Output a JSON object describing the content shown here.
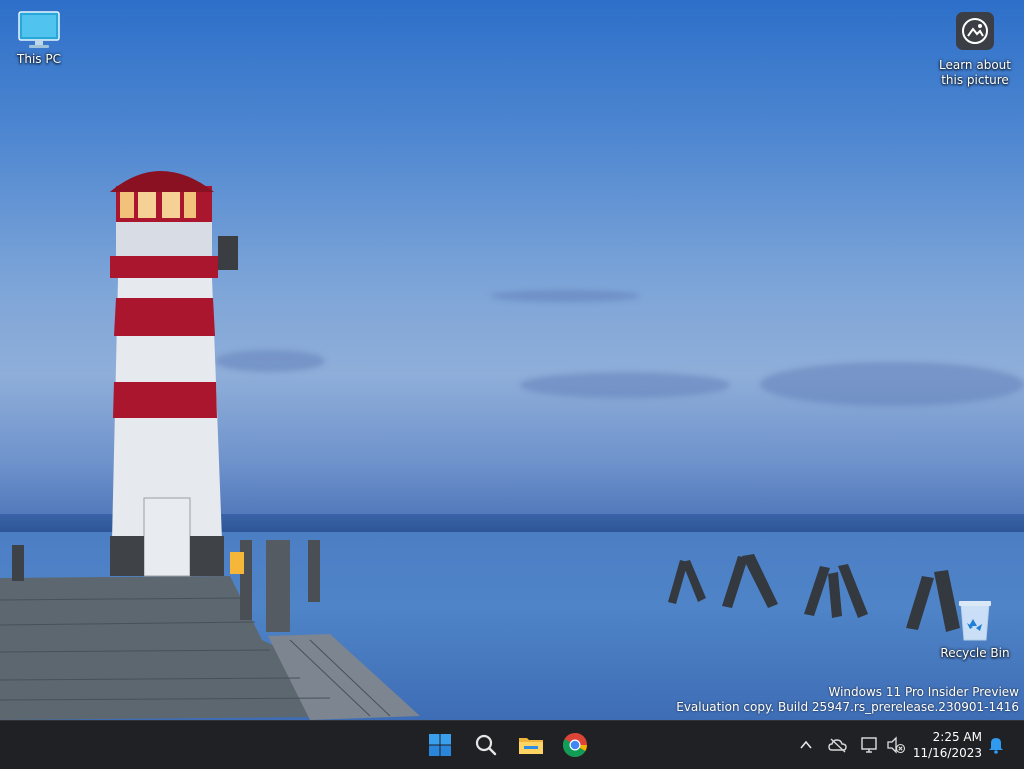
{
  "desktop": {
    "icons": [
      {
        "id": "this-pc",
        "label": "This PC"
      },
      {
        "id": "learn",
        "label": "Learn about this picture"
      },
      {
        "id": "recycle",
        "label": "Recycle Bin"
      }
    ],
    "watermark": {
      "line1": "Windows 11 Pro Insider Preview",
      "line2": "Evaluation copy. Build 25947.rs_prerelease.230901-1416"
    }
  },
  "taskbar": {
    "apps": [
      "start-icon",
      "search-icon",
      "file-explorer-icon",
      "chrome-icon"
    ],
    "clock": {
      "time": "2:25 AM",
      "date": "11/16/2023"
    }
  },
  "colors": {
    "taskbar": "#1f2124",
    "accent": "#2f8de6",
    "lighthouse_red": "#a9162d"
  }
}
